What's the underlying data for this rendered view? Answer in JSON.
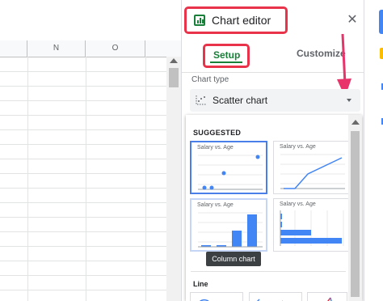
{
  "sheet": {
    "columns": [
      "",
      "N",
      "O",
      ""
    ]
  },
  "editor": {
    "title": "Chart editor",
    "close": "✕",
    "tabs": {
      "setup": "Setup",
      "customize": "Customize"
    },
    "chart_type_label": "Chart type",
    "selected_chart": "Scatter chart",
    "suggested_heading": "SUGGESTED",
    "thumbnails": [
      {
        "title": "Salary vs. Age",
        "kind": "scatter"
      },
      {
        "title": "Salary vs. Age",
        "kind": "line"
      },
      {
        "title": "Salary vs. Age",
        "kind": "column"
      },
      {
        "title": "Salary vs. Age",
        "kind": "bar"
      }
    ],
    "tooltip": "Column chart",
    "line_section": "Line"
  },
  "colors": {
    "accent_green": "#188038",
    "highlight_red": "#e8334a",
    "arrow_pink": "#e8336b",
    "chart_blue": "#4285f4"
  }
}
